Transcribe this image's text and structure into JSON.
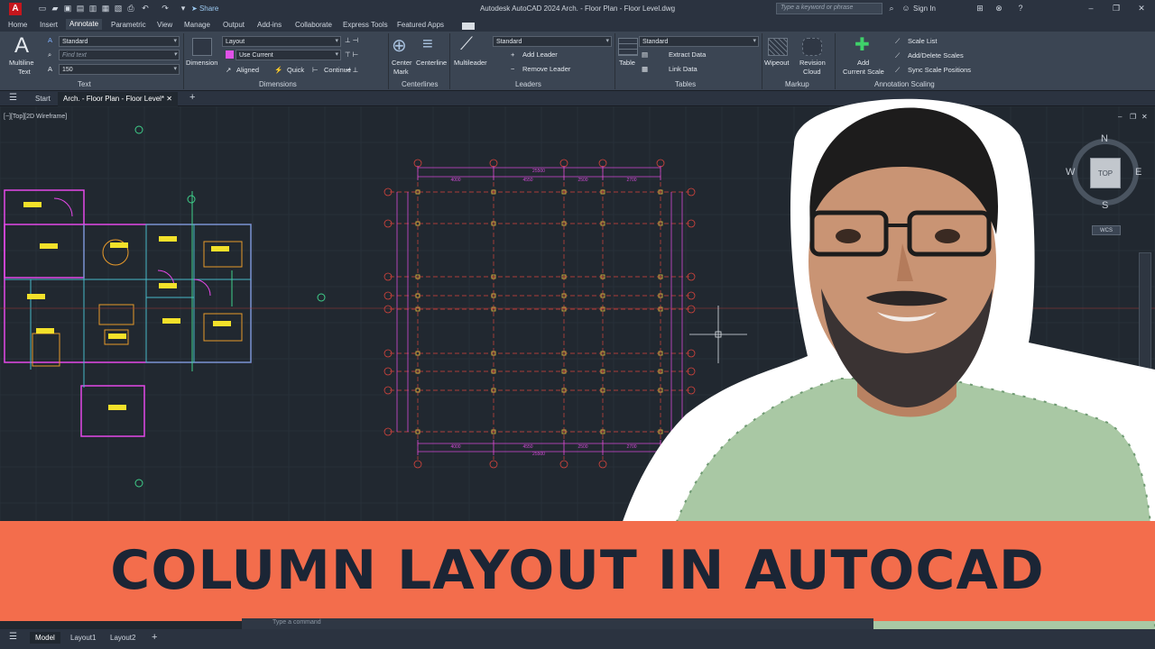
{
  "app": {
    "logo": "A",
    "title": "Autodesk AutoCAD 2024   Arch. - Floor Plan - Floor Level.dwg",
    "share_label": "Share",
    "search_placeholder": "Type a keyword or phrase",
    "signin_label": "Sign In"
  },
  "ribbon_tabs": [
    "Home",
    "Insert",
    "Annotate",
    "Parametric",
    "View",
    "Manage",
    "Output",
    "Add-ins",
    "Collaborate",
    "Express Tools",
    "Featured Apps"
  ],
  "ribbon": {
    "text_panel": {
      "multiline_label": "Multiline",
      "text_label": "Text",
      "style": "Standard",
      "find_placeholder": "Find text",
      "height": "150",
      "title": "Text"
    },
    "dimensions_panel": {
      "dimension_label": "Dimension",
      "layer": "Layout",
      "use_current": "Use Current",
      "aligned": "Aligned",
      "quick": "Quick",
      "continue": "Continue",
      "title": "Dimensions"
    },
    "centerlines_panel": {
      "center_label": "Center",
      "mark_label": "Mark",
      "centerline_label": "Centerline",
      "title": "Centerlines"
    },
    "leaders_panel": {
      "multileader_label": "Multileader",
      "style": "Standard",
      "add_leader": "Add Leader",
      "remove_leader": "Remove Leader",
      "title": "Leaders"
    },
    "tables_panel": {
      "table_label": "Table",
      "style": "Standard",
      "extract_data": "Extract Data",
      "link_data": "Link Data",
      "title": "Tables"
    },
    "markup_panel": {
      "wipeout_label": "Wipeout",
      "revision_label": "Revision",
      "cloud_label": "Cloud",
      "title": "Markup"
    },
    "scaling_panel": {
      "add_label": "Add",
      "current_scale_label": "Current Scale",
      "scale_list": "Scale List",
      "add_delete_scales": "Add/Delete Scales",
      "sync_scale_positions": "Sync Scale Positions",
      "title": "Annotation Scaling"
    }
  },
  "file_tabs": {
    "start": "Start",
    "active": "Arch. - Floor Plan - Floor Level*"
  },
  "view_label": "[−][Top][2D Wireframe]",
  "viewcube": {
    "n": "N",
    "s": "S",
    "e": "E",
    "w": "W",
    "top": "TOP",
    "wcs": "WCS"
  },
  "grid": {
    "top_overall": "25500",
    "bottom_overall": "25500",
    "top_spans": [
      "4000",
      "4550",
      "2500",
      "2700"
    ],
    "bottom_spans": [
      "4000",
      "4550",
      "2500",
      "2700"
    ]
  },
  "command_placeholder": "Type a command",
  "layout_tabs": [
    "Model",
    "Layout1",
    "Layout2"
  ],
  "banner": {
    "text": "COLUMN LAYOUT IN AUTOCAD"
  },
  "colors": {
    "banner": "#f36d4c",
    "banner_text": "#1b2535",
    "grid_red": "#d8443c",
    "dim_magenta": "#d24ad6"
  }
}
